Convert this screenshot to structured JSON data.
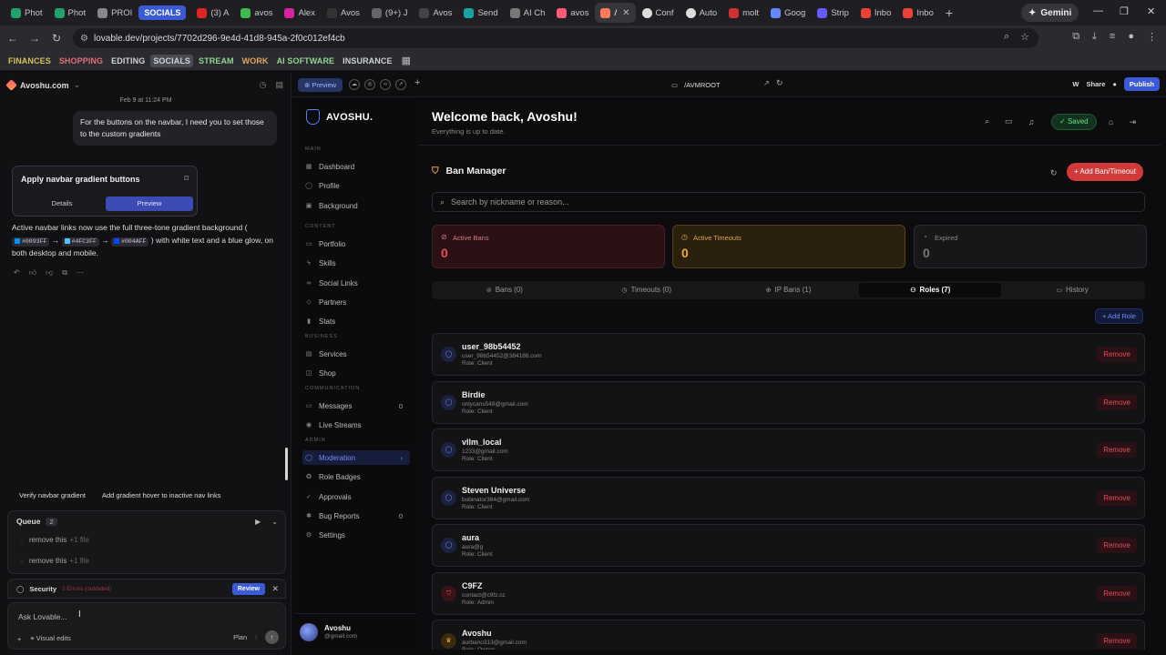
{
  "browser": {
    "tabs": [
      {
        "label": "Phot",
        "color": "#22a06b"
      },
      {
        "label": "Phot",
        "color": "#22a06b"
      },
      {
        "label": "PROI",
        "color": "#888888"
      },
      {
        "label": "(3) A",
        "color": "#e02424"
      },
      {
        "label": "avos",
        "color": "#3fb950"
      },
      {
        "label": "Alex",
        "color": "#d6249f"
      },
      {
        "label": "Avos",
        "color": "#eeeeee"
      },
      {
        "label": "(9+) J",
        "color": "#aaaaaa"
      },
      {
        "label": "Avos",
        "color": "#eeeeee"
      },
      {
        "label": "Send",
        "color": "#1ba1a1"
      },
      {
        "label": "AI Ch",
        "color": "#aaaaaa"
      },
      {
        "label": "avos",
        "color": "#ff5a7a"
      },
      {
        "label": "/",
        "color": "#ff7a5a"
      },
      {
        "label": "Conf",
        "color": "#dddddd"
      },
      {
        "label": "Auto",
        "color": "#dddddd"
      },
      {
        "label": "molt",
        "color": "#d03030"
      },
      {
        "label": "Goog",
        "color": "#6688ff"
      },
      {
        "label": "Strip",
        "color": "#635bff"
      },
      {
        "label": "Inbo",
        "color": "#ea4335"
      },
      {
        "label": "Inbo",
        "color": "#ea4335"
      }
    ],
    "group_label": "SOCIALS",
    "gemini_label": "Gemini",
    "url": "lovable.dev/projects/7702d296-9e4d-41d8-945a-2f0c012ef4cb",
    "bookmarks": [
      "FINANCES",
      "SHOPPING",
      "EDITING",
      "SOCIALS",
      "STREAM",
      "WORK",
      "AI SOFTWARE",
      "INSURANCE"
    ]
  },
  "chat": {
    "project": "Avoshu.com",
    "timestamp": "Feb 9 at 11:24 PM",
    "user_message": "For the buttons on the navbar, I need you to set those to the custom gradients",
    "card": {
      "title": "Apply navbar gradient buttons",
      "tab_details": "Details",
      "tab_preview": "Preview"
    },
    "assistant_pre": "Active navbar links now use the full three-tone gradient background (",
    "colors": [
      {
        "hex": "#0093FF",
        "swatch": "#0093FF"
      },
      {
        "hex": "#4FC3FF",
        "swatch": "#4FC3FF"
      },
      {
        "hex": "#004AFF",
        "swatch": "#004AFF"
      }
    ],
    "arrow": "→",
    "assistant_post": ") with white text and a blue glow, on both desktop and mobile.",
    "suggestions": [
      "Verify navbar gradient",
      "Add gradient hover to inactive nav links"
    ],
    "queue": {
      "title": "Queue",
      "count": "2",
      "items": [
        {
          "text": "remove this",
          "files": "+1 file"
        },
        {
          "text": "remove this",
          "files": "+1 file"
        }
      ]
    },
    "security": {
      "title": "Security",
      "errors": "3 Errors (outdated)",
      "review": "Review"
    },
    "composer": {
      "placeholder": "Ask Lovable...",
      "visual_edits": "Visual edits",
      "plan": "Plan"
    }
  },
  "preview_toolbar": {
    "preview_label": "Preview",
    "route": "/AVMROOT",
    "share": "Share",
    "publish": "Publish",
    "w_label": "W"
  },
  "site": {
    "brand": "AVOSHU.",
    "sections": {
      "main": "MAIN",
      "content": "CONTENT",
      "business": "BUSINESS",
      "communication": "COMMUNICATION",
      "admin": "ADMIN"
    },
    "nav": {
      "dashboard": "Dashboard",
      "profile": "Profile",
      "background": "Background",
      "portfolio": "Portfolio",
      "skills": "Skills",
      "social_links": "Social Links",
      "partners": "Partners",
      "stats": "Stats",
      "services": "Services",
      "shop": "Shop",
      "messages": "Messages",
      "messages_count": "0",
      "live_streams": "Live Streams",
      "moderation": "Moderation",
      "moderation_arrow": "›",
      "role_badges": "Role Badges",
      "approvals": "Approvals",
      "bug_reports": "Bug Reports",
      "bug_reports_count": "0",
      "settings": "Settings"
    },
    "user": {
      "name": "Avoshu",
      "email": "@gmail.com"
    }
  },
  "main": {
    "welcome": "Welcome back, Avoshu!",
    "subtitle": "Everything is up to date.",
    "saved": "Saved",
    "ban_manager": "Ban Manager",
    "add_ban": "Add Ban/Timeout",
    "search_placeholder": "Search by nickname or reason...",
    "stats": [
      {
        "label": "Active Bans",
        "value": "0"
      },
      {
        "label": "Active Timeouts",
        "value": "0"
      },
      {
        "label": "Expired",
        "value": "0"
      }
    ],
    "tabs": [
      "Bans (0)",
      "Timeouts (0)",
      "IP Bans (1)",
      "Roles (7)",
      "History"
    ],
    "add_role": "+ Add Role",
    "roles": [
      {
        "name": "user_98b54452",
        "email": "user_98b54452@384188.com",
        "role": "Role: Client",
        "remove": "Remove"
      },
      {
        "name": "Birdie",
        "email": "onlycans548@gmail.com",
        "role": "Role: Client",
        "remove": "Remove"
      },
      {
        "name": "vllm_local",
        "email": "1233@gmail.com",
        "role": "Role: Client",
        "remove": "Remove"
      },
      {
        "name": "Steven Universe",
        "email": "bubinator384@gmail.com",
        "role": "Role: Client",
        "remove": "Remove"
      },
      {
        "name": "aura",
        "email": "aura@g",
        "role": "Role: Client",
        "remove": "Remove"
      },
      {
        "name": "C9FZ",
        "email": "contact@c9fz.cc",
        "role": "Role: Admin",
        "remove": "Remove"
      },
      {
        "name": "Avoshu",
        "email": "aurbano313@gmail.com",
        "role": "Role: Owner",
        "remove": "Remove"
      }
    ]
  }
}
